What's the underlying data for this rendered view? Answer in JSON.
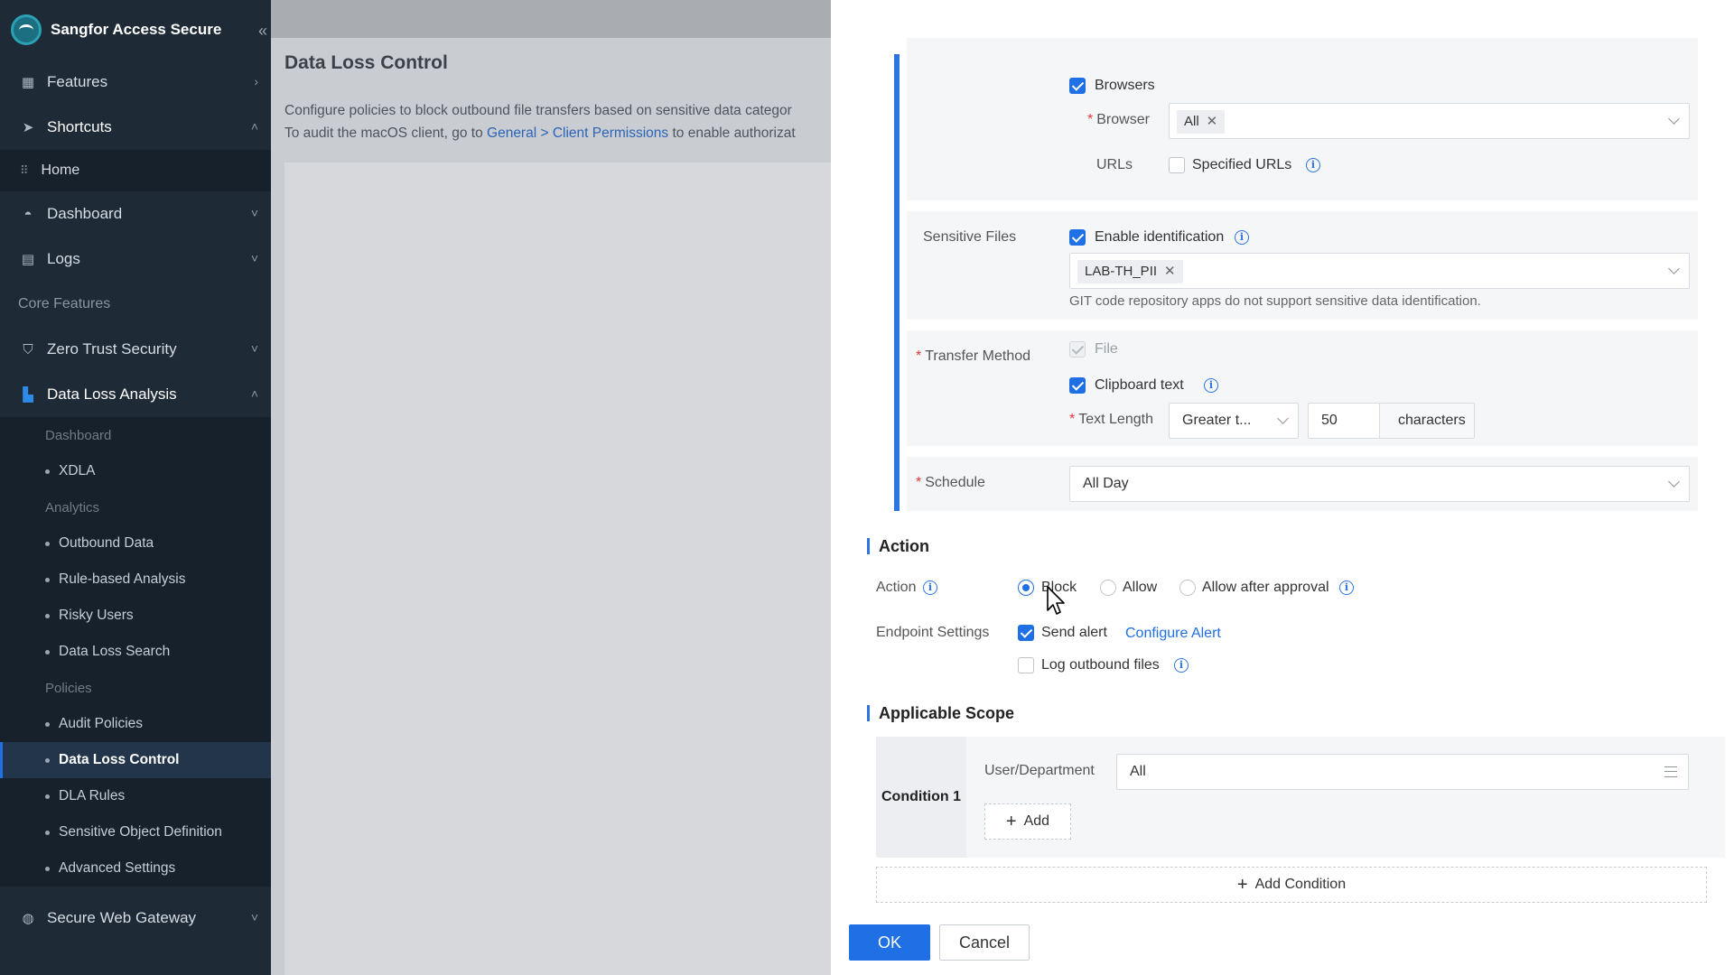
{
  "sidebar": {
    "brand": "Sangfor Access Secure",
    "items": {
      "features": "Features",
      "shortcuts": "Shortcuts",
      "home": "Home",
      "dashboard": "Dashboard",
      "logs": "Logs",
      "core_features": "Core Features",
      "zero_trust": "Zero Trust Security",
      "data_loss_analysis": "Data Loss Analysis",
      "secure_web_gateway": "Secure Web Gateway"
    },
    "dla": {
      "dashboard_label": "Dashboard",
      "xdla": "XDLA",
      "analytics_label": "Analytics",
      "outbound_data": "Outbound Data",
      "rule_based": "Rule-based Analysis",
      "risky_users": "Risky Users",
      "data_loss_search": "Data Loss Search",
      "policies_label": "Policies",
      "audit_policies": "Audit Policies",
      "data_loss_control": "Data Loss Control",
      "dla_rules": "DLA Rules",
      "sensitive_object": "Sensitive Object Definition",
      "advanced_settings": "Advanced Settings"
    }
  },
  "main": {
    "title": "Data Loss Control",
    "desc_line1": "Configure policies to block outbound file transfers based on sensitive data categor",
    "desc_line2_prefix": "To audit the macOS client, go to ",
    "desc_link": "General > Client Permissions",
    "desc_line2_suffix": " to enable authorizat"
  },
  "drawer": {
    "browsers_label": "Browsers",
    "browser_field_label": "Browser",
    "browser_tag": "All",
    "urls_label": "URLs",
    "specified_urls": "Specified URLs",
    "sensitive_files_label": "Sensitive Files",
    "enable_identification": "Enable identification",
    "sensitive_tag": "LAB-TH_PII",
    "git_hint": "GIT code repository apps do not support sensitive data identification.",
    "transfer_method_label": "Transfer Method",
    "file_label": "File",
    "clipboard_label": "Clipboard text",
    "text_length_label": "Text Length",
    "text_length_operator": "Greater t...",
    "text_length_value": "50",
    "characters_label": "characters",
    "schedule_label": "Schedule",
    "schedule_value": "All Day",
    "action_section": "Action",
    "action_label": "Action",
    "action_block": "Block",
    "action_allow": "Allow",
    "action_allow_after_approval": "Allow after approval",
    "endpoint_settings_label": "Endpoint Settings",
    "send_alert": "Send alert",
    "configure_alert": "Configure Alert",
    "log_outbound_files": "Log outbound files",
    "scope_section": "Applicable Scope",
    "condition_label": "Condition 1",
    "user_department_label": "User/Department",
    "user_department_value": "All",
    "add_label": "Add",
    "add_condition_label": "Add Condition",
    "ok_label": "OK",
    "cancel_label": "Cancel"
  },
  "colors": {
    "accent": "#1f6fe5",
    "sidebar_bg": "#1e2a36",
    "required": "#e5373b"
  }
}
